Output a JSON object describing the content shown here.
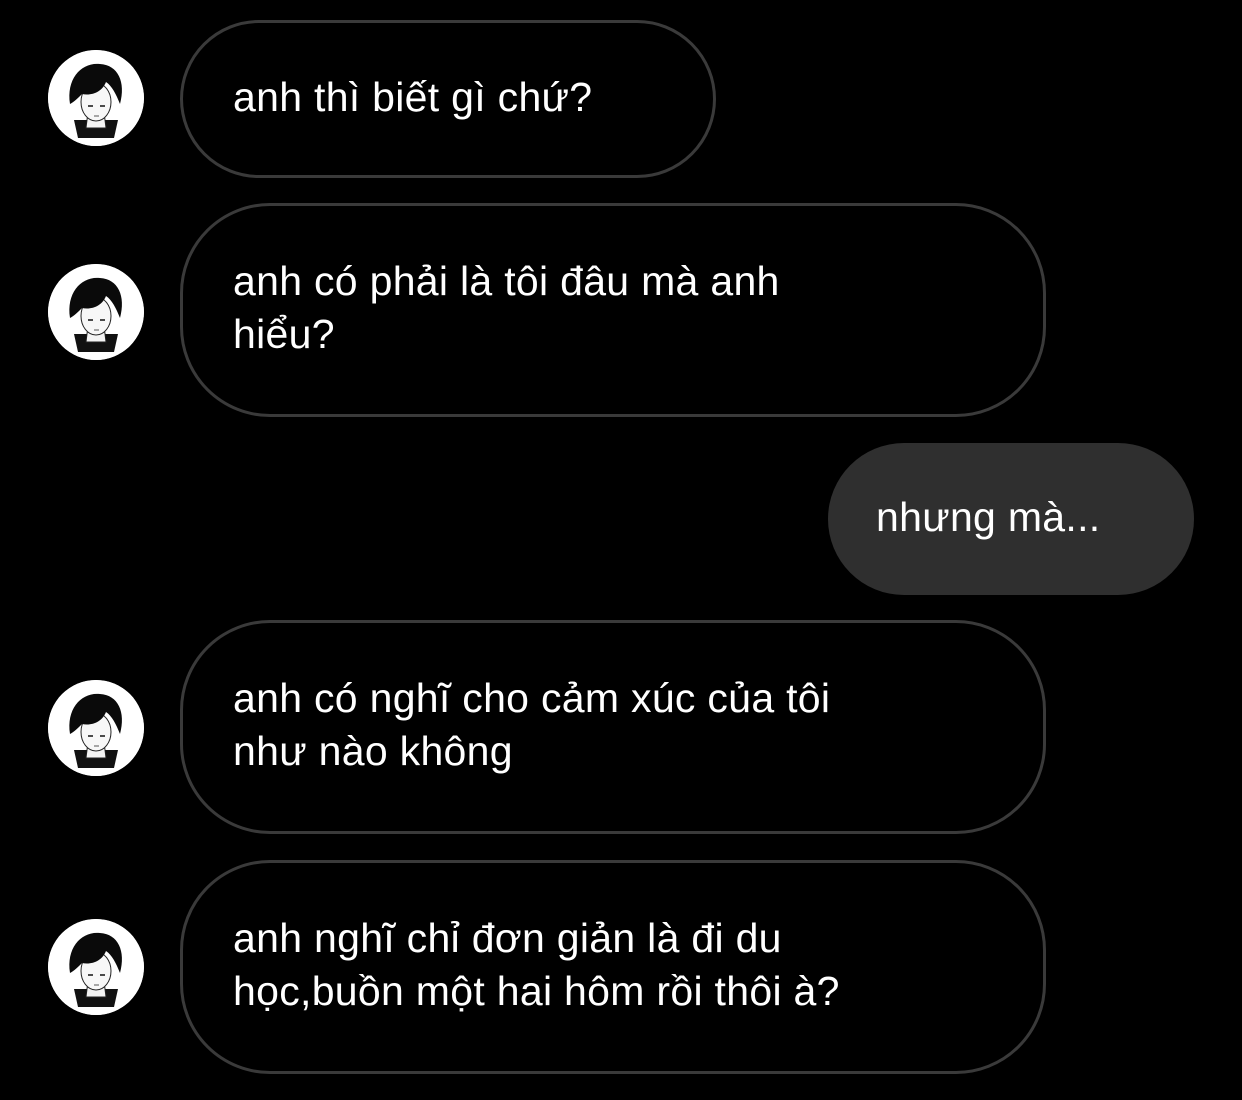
{
  "theme": {
    "background": "#000000",
    "received_bubble_border": "#3a3a3a",
    "sent_bubble_fill": "#2f2f2f",
    "text_color": "#ffffff"
  },
  "messages": [
    {
      "direction": "received",
      "text": "anh thì biết gì chứ?",
      "avatar_icon": "contact-avatar-icon"
    },
    {
      "direction": "received",
      "text": "anh có phải là tôi đâu mà anh\nhiểu?",
      "avatar_icon": "contact-avatar-icon"
    },
    {
      "direction": "sent",
      "text": "nhưng mà..."
    },
    {
      "direction": "received",
      "text": "anh có nghĩ cho cảm xúc của tôi\nnhư nào không",
      "avatar_icon": "contact-avatar-icon"
    },
    {
      "direction": "received",
      "text": "anh nghĩ chỉ đơn giản là đi du\nhọc,buồn một hai hôm rồi thôi à?",
      "avatar_icon": "contact-avatar-icon"
    }
  ]
}
